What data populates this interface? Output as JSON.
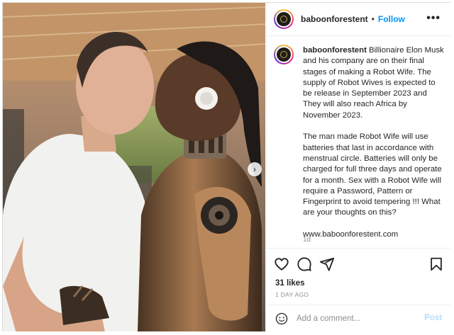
{
  "post": {
    "username": "baboonforestent",
    "follow_label": "Follow",
    "separator": "•",
    "more_label": "•••",
    "caption_username": "baboonforestent",
    "caption_p1": "Billionaire Elon Musk and his company are on their final stages of making a Robot Wife. The supply of Robot Wives is expected to be release in September 2023 and They will also reach Africa by November 2023.",
    "caption_p2": "The man made Robot Wife will use batteries that last in accordance with menstrual circle. Batteries will only be charged for full three days and operate for a month. Sex with a Robot Wife will require a Password, Pattern or Fingerprint to avoid tempering !!! What are your thoughts on this?",
    "caption_link": "www.baboonforestent.com",
    "caption_time": "1d",
    "likes": "31 likes",
    "posted_ago": "1 DAY AGO",
    "comment_placeholder": "Add a comment...",
    "post_label": "Post",
    "carousel_next": "›"
  },
  "colors": {
    "accent": "#0095f6",
    "post_disabled": "#b2dffc",
    "muted": "#8e8e8e",
    "text": "#262626"
  },
  "icons": [
    "avatar-logo",
    "more-icon",
    "heart-icon",
    "comment-icon",
    "share-icon",
    "bookmark-icon",
    "emoji-icon",
    "chevron-right-icon"
  ]
}
